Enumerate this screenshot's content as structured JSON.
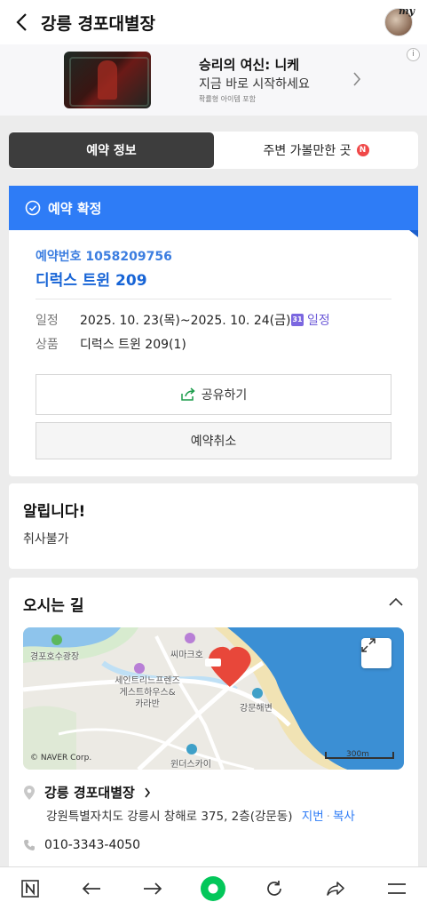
{
  "header": {
    "title": "강릉 경포대별장",
    "avatar_label": "my"
  },
  "ad": {
    "title": "승리의 여신: 니케",
    "subtitle": "지금 바로 시작하세요",
    "note": "확률형 아이템 포함",
    "info_label": "i"
  },
  "tabs": [
    {
      "label": "예약 정보",
      "active": true
    },
    {
      "label": "주변 가볼만한 곳",
      "badge": "N"
    }
  ],
  "reservation": {
    "status": "예약 확정",
    "number_text": "예약번호 1058209756",
    "room": "디럭스 트윈 209",
    "date_label": "일정",
    "date_value": "2025. 10. 23(목)~2025. 10. 24(금)",
    "calendar_label": "일정",
    "calendar_icon_text": "31",
    "product_label": "상품",
    "product_value": "디럭스 트윈 209(1)",
    "share_label": "공유하기",
    "cancel_label": "예약취소"
  },
  "notice": {
    "title": "알립니다!",
    "body": "취사불가"
  },
  "directions": {
    "title": "오시는 길",
    "map_labels": {
      "park": "경포호수광장",
      "mart": "씨마크호",
      "guesthouse": "세인트리느프렌즈\n게스트하우스&\n카라반",
      "beach": "강문해변",
      "sky": "윈더스카이",
      "copyright": "© NAVER Corp.",
      "scale": "300m"
    },
    "place_name": "강릉 경포대별장",
    "address": "강원특별자치도 강릉시 창해로 375, 2층(강문동)",
    "address_link1": "지번",
    "address_link2": "복사",
    "phone": "010-3343-4050"
  },
  "colors": {
    "accent": "#2e7cf6",
    "tab_active": "#3d3d3d",
    "naver_green": "#03c75a"
  }
}
